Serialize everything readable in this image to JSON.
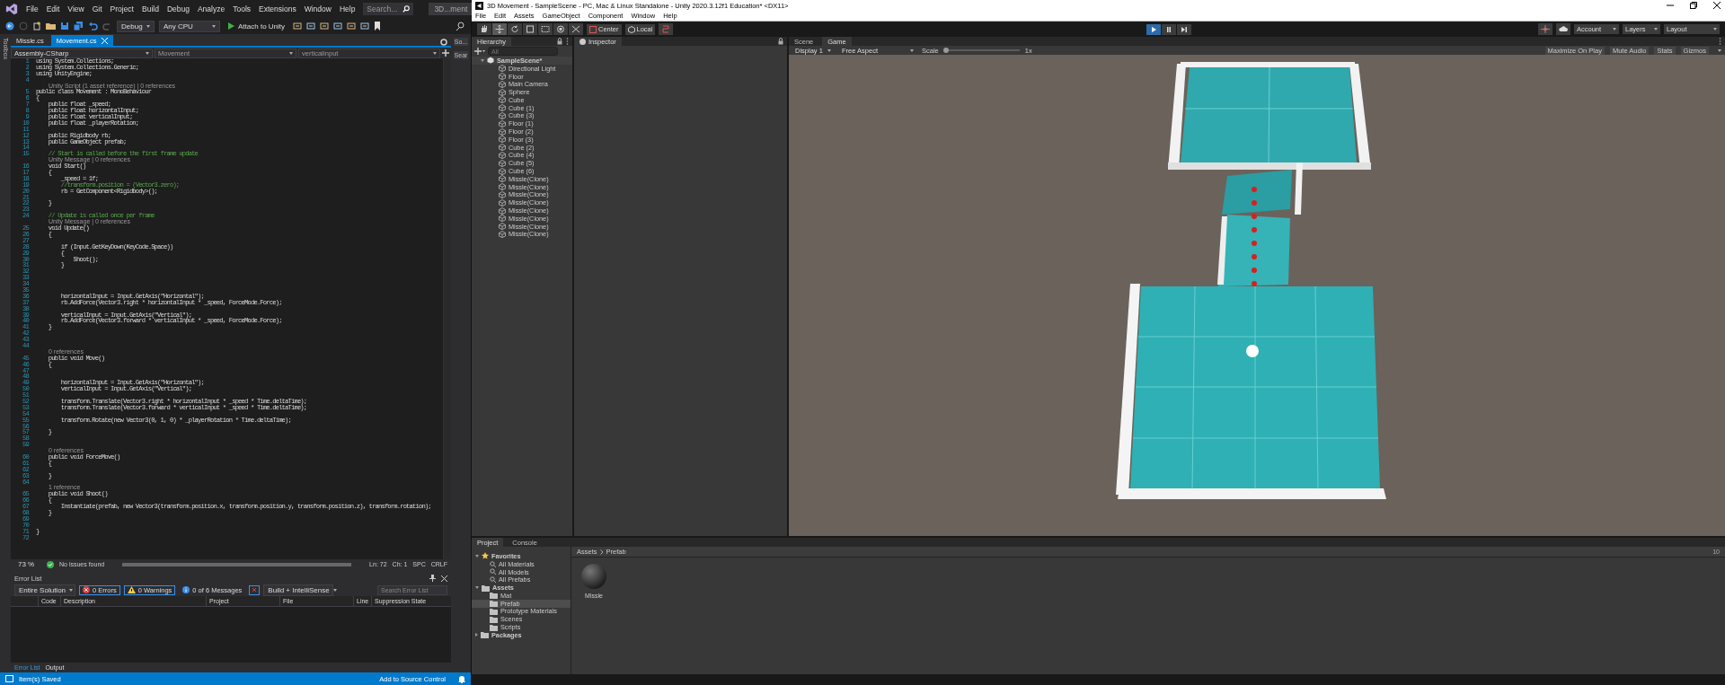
{
  "vs": {
    "menu": [
      "File",
      "Edit",
      "View",
      "Git",
      "Project",
      "Build",
      "Debug",
      "Analyze",
      "Tools",
      "Extensions",
      "Window",
      "Help"
    ],
    "search": "Search...",
    "title": "3D...ment",
    "toolbar": {
      "config": "Debug",
      "platform": "Any CPU",
      "run": "Attach to Unity"
    },
    "side_label": "Toolbox",
    "tabs": [
      {
        "label": "Missle.cs",
        "selected": false
      },
      {
        "label": "Movement.cs",
        "selected": true
      }
    ],
    "nav": [
      "Assembly-CSharp",
      "Movement",
      "verticalInput"
    ],
    "code": [
      {
        "kind": "code",
        "num": "1",
        "text": "using System.Collections;"
      },
      {
        "kind": "code",
        "num": "2",
        "text": "using System.Collections.Generic;"
      },
      {
        "kind": "code",
        "num": "3",
        "text": "using UnityEngine;"
      },
      {
        "kind": "code",
        "num": "4"
      },
      {
        "kind": "lens",
        "text": "Unity Script (1 asset reference) | 0 references"
      },
      {
        "kind": "code",
        "num": "5",
        "text": "public class Movement : MonoBehaviour"
      },
      {
        "kind": "code",
        "num": "6",
        "text": "{"
      },
      {
        "kind": "code",
        "num": "7",
        "text": "    public float _speed;"
      },
      {
        "kind": "code",
        "num": "8",
        "text": "    public float horizontalInput;"
      },
      {
        "kind": "code",
        "num": "9",
        "text": "    public float verticalInput;"
      },
      {
        "kind": "code",
        "num": "10",
        "text": "    public float _playerRotation;"
      },
      {
        "kind": "code",
        "num": "11"
      },
      {
        "kind": "code",
        "num": "12",
        "text": "    public Rigidbody rb;"
      },
      {
        "kind": "code",
        "num": "13",
        "text": "    public GameObject prefab;"
      },
      {
        "kind": "code",
        "num": "14"
      },
      {
        "kind": "comment",
        "num": "15",
        "text": "    // Start is called before the first frame update"
      },
      {
        "kind": "lens",
        "text": "Unity Message | 0 references"
      },
      {
        "kind": "code",
        "num": "16",
        "text": "    void Start()"
      },
      {
        "kind": "code",
        "num": "17",
        "text": "    {"
      },
      {
        "kind": "code",
        "num": "18",
        "text": "        _speed = 1f;"
      },
      {
        "kind": "comment",
        "num": "19",
        "text": "        //transform.position = (Vector3.zero);"
      },
      {
        "kind": "code",
        "num": "20",
        "text": "        rb = GetComponent<Rigidbody>();"
      },
      {
        "kind": "code",
        "num": "21"
      },
      {
        "kind": "code",
        "num": "22",
        "text": "    }"
      },
      {
        "kind": "code",
        "num": "23"
      },
      {
        "kind": "comment",
        "num": "24",
        "text": "    // Update is called once per frame"
      },
      {
        "kind": "lens",
        "text": "Unity Message | 0 references"
      },
      {
        "kind": "code",
        "num": "25",
        "text": "    void Update()"
      },
      {
        "kind": "code",
        "num": "26",
        "text": "    {"
      },
      {
        "kind": "code",
        "num": "27"
      },
      {
        "kind": "code",
        "num": "28",
        "text": "        if (Input.GetKeyDown(KeyCode.Space))"
      },
      {
        "kind": "code",
        "num": "29",
        "text": "        {"
      },
      {
        "kind": "code",
        "num": "30",
        "text": "            Shoot();"
      },
      {
        "kind": "code",
        "num": "31",
        "text": "        }"
      },
      {
        "kind": "code",
        "num": "32"
      },
      {
        "kind": "code",
        "num": "33"
      },
      {
        "kind": "code",
        "num": "34"
      },
      {
        "kind": "code",
        "num": "35"
      },
      {
        "kind": "code",
        "num": "36",
        "text": "        horizontalInput = Input.GetAxis(\"Horizontal\");"
      },
      {
        "kind": "code",
        "num": "37",
        "text": "        rb.AddForce(Vector3.right * horizontalInput * _speed, ForceMode.Force);"
      },
      {
        "kind": "code",
        "num": "38"
      },
      {
        "kind": "code",
        "num": "39",
        "text": "        verticalInput = Input.GetAxis(\"Vertical\");"
      },
      {
        "kind": "code",
        "num": "40",
        "text": "        rb.AddForce(Vector3.forward * verticalInput * _speed, ForceMode.Force);"
      },
      {
        "kind": "code",
        "num": "41",
        "text": "    }"
      },
      {
        "kind": "code",
        "num": "42"
      },
      {
        "kind": "code",
        "num": "43"
      },
      {
        "kind": "code",
        "num": "44"
      },
      {
        "kind": "lens",
        "text": "0 references"
      },
      {
        "kind": "code",
        "num": "45",
        "text": "    public void Move()"
      },
      {
        "kind": "code",
        "num": "46",
        "text": "    {"
      },
      {
        "kind": "code",
        "num": "47"
      },
      {
        "kind": "code",
        "num": "48"
      },
      {
        "kind": "code",
        "num": "49",
        "text": "        horizontalInput = Input.GetAxis(\"Horizontal\");"
      },
      {
        "kind": "code",
        "num": "50",
        "text": "        verticalInput = Input.GetAxis(\"Vertical\");"
      },
      {
        "kind": "code",
        "num": "51"
      },
      {
        "kind": "code",
        "num": "52",
        "text": "        transform.Translate(Vector3.right * horizontalInput * _speed * Time.deltaTime);"
      },
      {
        "kind": "code",
        "num": "53",
        "text": "        transform.Translate(Vector3.forward * verticalInput * _speed * Time.deltaTime);"
      },
      {
        "kind": "code",
        "num": "54"
      },
      {
        "kind": "code",
        "num": "55",
        "text": "        transform.Rotate(new Vector3(0, 1, 0) * _playerRotation * Time.deltaTime);"
      },
      {
        "kind": "code",
        "num": "56"
      },
      {
        "kind": "code",
        "num": "57",
        "text": "    }"
      },
      {
        "kind": "code",
        "num": "58"
      },
      {
        "kind": "code",
        "num": "59"
      },
      {
        "kind": "lens",
        "text": "0 references"
      },
      {
        "kind": "code",
        "num": "60",
        "text": "    public void ForceMove()"
      },
      {
        "kind": "code",
        "num": "61",
        "text": "    {"
      },
      {
        "kind": "code",
        "num": "62"
      },
      {
        "kind": "code",
        "num": "63",
        "text": "    }"
      },
      {
        "kind": "code",
        "num": "64"
      },
      {
        "kind": "lens",
        "text": "1 reference"
      },
      {
        "kind": "code",
        "num": "65",
        "text": "    public void Shoot()"
      },
      {
        "kind": "code",
        "num": "66",
        "text": "    {"
      },
      {
        "kind": "code",
        "num": "67",
        "text": "        Instantiate(prefab, new Vector3(transform.position.x, transform.position.y, transform.position.z), transform.rotation);"
      },
      {
        "kind": "code",
        "num": "68",
        "text": "    }"
      },
      {
        "kind": "code",
        "num": "69"
      },
      {
        "kind": "code",
        "num": "70"
      },
      {
        "kind": "code",
        "num": "71",
        "text": "}"
      },
      {
        "kind": "code",
        "num": "72"
      }
    ],
    "right_strip": [
      "So...",
      "Sear"
    ],
    "status": {
      "zoom": "73 %",
      "issues": "No issues found",
      "ln": "Ln: 72",
      "ch": "Ch: 1",
      "spc": "SPC",
      "eol": "CRLF"
    },
    "error_list": {
      "title": "Error List",
      "scope": "Entire Solution",
      "errors": "0 Errors",
      "warnings": "0 Warnings",
      "messages": "0 of 6 Messages",
      "source": "Build + IntelliSense",
      "search_placeholder": "Search Error List",
      "columns": [
        "Code",
        "Description",
        "Project",
        "File",
        "Line",
        "Suppression State"
      ],
      "tabs": [
        {
          "label": "Error List",
          "selected": true
        },
        {
          "label": "Output",
          "selected": false
        }
      ]
    },
    "status_bar": {
      "message": "Item(s) Saved",
      "source_control": "Add to Source Control"
    }
  },
  "unity": {
    "title": "3D Movement - SampleScene - PC, Mac & Linux Standalone - Unity 2020.3.12f1 Education* <DX11>",
    "menu": [
      "File",
      "Edit",
      "Assets",
      "GameObject",
      "Component",
      "Window",
      "Help"
    ],
    "pivot": [
      "Center",
      "Local"
    ],
    "playing": true,
    "right_buttons": [
      "Account",
      "Layers",
      "Layout"
    ],
    "hierarchy": {
      "title": "Hierarchy",
      "search_placeholder": "All",
      "scene": "SampleScene*",
      "items": [
        "Directional Light",
        "Floor",
        "Main Camera",
        "Sphere",
        "Cube",
        "Cube (1)",
        "Cube (3)",
        "Floor (1)",
        "Floor (2)",
        "Floor (3)",
        "Cube (2)",
        "Cube (4)",
        "Cube (5)",
        "Cube (6)",
        "Missle(Clone)",
        "Missle(Clone)",
        "Missle(Clone)",
        "Missle(Clone)",
        "Missle(Clone)",
        "Missle(Clone)",
        "Missle(Clone)",
        "Missle(Clone)"
      ]
    },
    "inspector": {
      "title": "Inspector"
    },
    "game": {
      "tabs": [
        {
          "label": "Scene",
          "selected": false
        },
        {
          "label": "Game",
          "selected": true
        }
      ],
      "display": "Display 1",
      "aspect": "Free Aspect",
      "scale_label": "Scale",
      "scale": {
        "level": 0,
        "reading": "1x"
      },
      "toggles": [
        "Maximize On Play",
        "Mute Audio",
        "Stats",
        "Gizmos"
      ]
    },
    "project": {
      "tabs": [
        {
          "label": "Project",
          "selected": true
        },
        {
          "label": "Console",
          "selected": false
        }
      ],
      "tree": [
        {
          "label": "Favorites",
          "kind": "favorites",
          "expanded": true,
          "children": [
            {
              "label": "All Materials",
              "selected": false
            },
            {
              "label": "All Models",
              "selected": false
            },
            {
              "label": "All Prefabs",
              "selected": false
            }
          ]
        },
        {
          "label": "Assets",
          "kind": "folder",
          "expanded": true,
          "children": [
            {
              "label": "Mat",
              "selected": false
            },
            {
              "label": "Prefab",
              "selected": true
            },
            {
              "label": "Prototype Materials",
              "selected": false
            },
            {
              "label": "Scenes",
              "selected": false
            },
            {
              "label": "Scripts",
              "selected": false
            }
          ]
        },
        {
          "label": "Packages",
          "kind": "folder",
          "expanded": false
        }
      ],
      "breadcrumb": [
        "Assets",
        "Prefab"
      ],
      "count": "10",
      "assets": [
        {
          "label": "Missle"
        }
      ]
    }
  }
}
